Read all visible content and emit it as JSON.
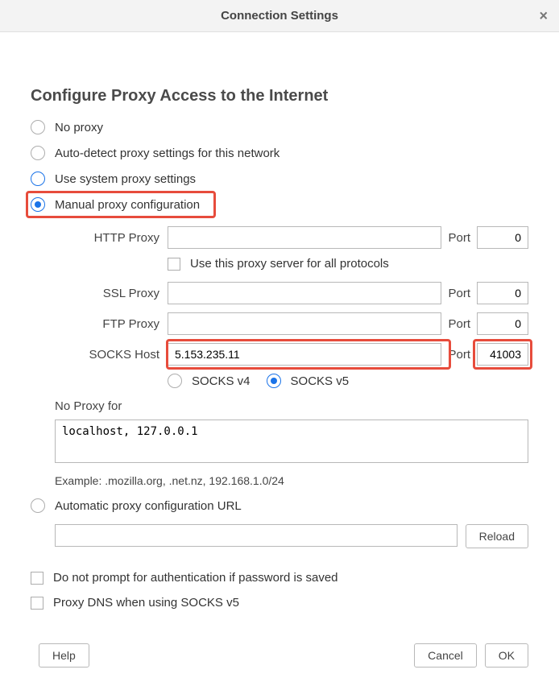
{
  "title": "Connection Settings",
  "heading": "Configure Proxy Access to the Internet",
  "options": {
    "no_proxy": "No proxy",
    "auto_detect": "Auto-detect proxy settings for this network",
    "use_system": "Use system proxy settings",
    "manual": "Manual proxy configuration",
    "auto_url": "Automatic proxy configuration URL"
  },
  "fields": {
    "http_label": "HTTP Proxy",
    "http_value": "",
    "http_port": "0",
    "use_all_label": "Use this proxy server for all protocols",
    "ssl_label": "SSL Proxy",
    "ssl_value": "",
    "ssl_port": "0",
    "ftp_label": "FTP Proxy",
    "ftp_value": "",
    "ftp_port": "0",
    "socks_label": "SOCKS Host",
    "socks_value": "5.153.235.11",
    "socks_port": "41003",
    "port_label": "Port",
    "socks_v4": "SOCKS v4",
    "socks_v5": "SOCKS v5",
    "noproxy_label": "No Proxy for",
    "noproxy_value": "localhost, 127.0.0.1",
    "example": "Example: .mozilla.org, .net.nz, 192.168.1.0/24",
    "auto_url_value": "",
    "reload": "Reload"
  },
  "checks": {
    "no_prompt": "Do not prompt for authentication if password is saved",
    "proxy_dns": "Proxy DNS when using SOCKS v5"
  },
  "buttons": {
    "help": "Help",
    "cancel": "Cancel",
    "ok": "OK"
  }
}
